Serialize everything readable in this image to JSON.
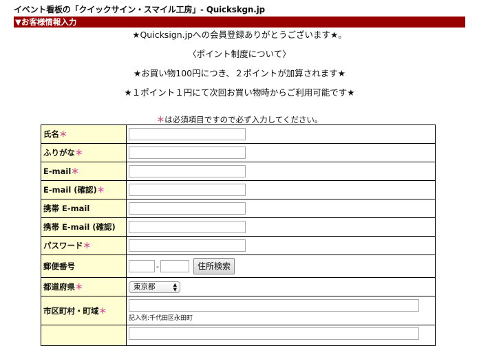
{
  "header": {
    "site_title": "イベント看板の「クイックサイン・スマイル工房」- Quickskgn.jp",
    "section_title": "▼お客様情報入力"
  },
  "notices": {
    "thanks": "★Quicksign.jpへの会員登録ありがとうございます★。",
    "points_heading": "〈ポイント制度について〉",
    "points_rule": "★お買い物100円につき、２ポイントが加算されます★",
    "points_usage": "★１ポイント１円にて次回お買い物時からご利用可能です★"
  },
  "required_note": {
    "mark": "＊",
    "text": "は必須項目ですので必ず入力してください。"
  },
  "form": {
    "required_mark": "＊",
    "rows": [
      {
        "label": "氏名",
        "value": ""
      },
      {
        "label": "ふりがな",
        "value": ""
      },
      {
        "label": "E-mail",
        "value": ""
      },
      {
        "label": "E-mail (確認)",
        "value": ""
      },
      {
        "label": "携帯 E-mail",
        "value": ""
      },
      {
        "label": "携帯 E-mail (確認)",
        "value": ""
      },
      {
        "label": "パスワード",
        "value": ""
      },
      {
        "label": "郵便番号",
        "zip1": "",
        "zip2": "",
        "separator": "-",
        "button": "住所検索"
      },
      {
        "label": "都道府県",
        "selected": "東京都"
      },
      {
        "label": "市区町村・町域",
        "value": "",
        "example": "記入例:千代田区永田町"
      }
    ]
  },
  "colors": {
    "section_bar": "#990000",
    "label_bg": "#fffdd2",
    "required": "#d6539a"
  }
}
